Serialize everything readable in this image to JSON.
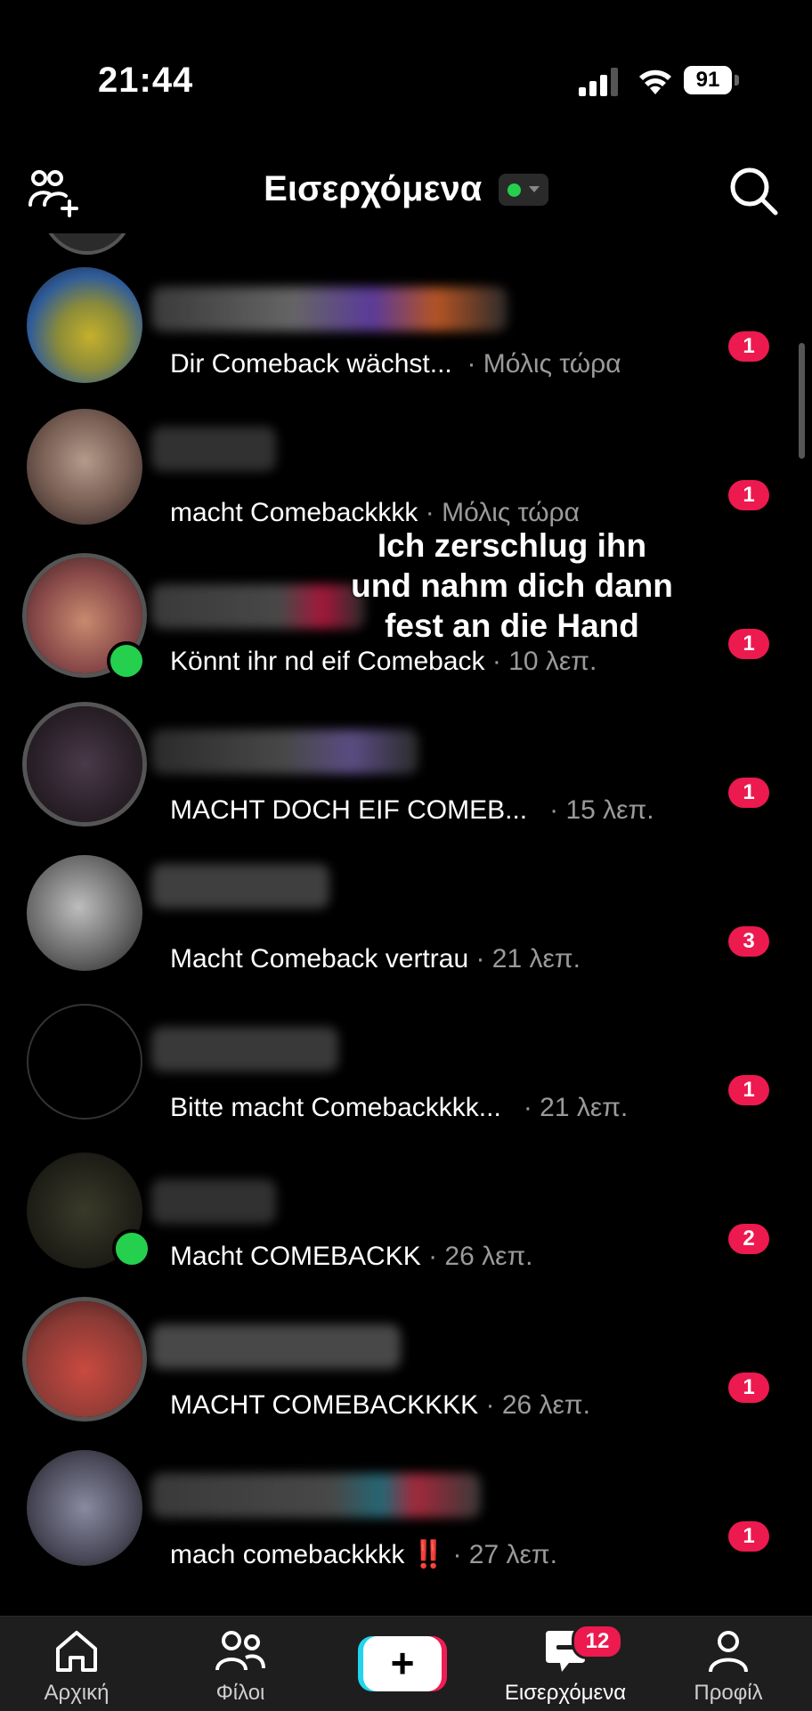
{
  "status_bar": {
    "time": "21:44",
    "battery": "91"
  },
  "header": {
    "title": "Εισερχόμενα"
  },
  "conversations": [
    {
      "message": "Dir Comeback wächst...",
      "time": "· Μόλις τώρα",
      "unread": "1"
    },
    {
      "message": "macht Comebackkkk",
      "time": "· Μόλις τώρα",
      "unread": "1"
    },
    {
      "message": "Könnt ihr nd eif Comeback",
      "time": "· 10 λεπ.",
      "unread": "1"
    },
    {
      "message": "MACHT DOCH EIF COMEB...",
      "time": "· 15 λεπ.",
      "unread": "1"
    },
    {
      "message": "Macht Comeback vertrau",
      "time": "· 21 λεπ.",
      "unread": "3"
    },
    {
      "message": "Bitte macht Comebackkkk...",
      "time": "· 21 λεπ.",
      "unread": "1"
    },
    {
      "message": "Macht COMEBACKK",
      "time": "· 26 λεπ.",
      "unread": "2"
    },
    {
      "message": "MACHT COMEBACKKKK",
      "time": "· 26 λεπ.",
      "unread": "1"
    },
    {
      "message": "mach comebackkkk ‼️",
      "time": "· 27 λεπ.",
      "unread": "1"
    }
  ],
  "overlay_caption": [
    "Ich zerschlug ihn",
    "und nahm dich dann",
    "fest an die Hand"
  ],
  "tab_bar": {
    "home": "Αρχική",
    "friends": "Φίλοι",
    "create": "+",
    "inbox": "Εισερχόμενα",
    "inbox_badge": "12",
    "profile": "Προφίλ"
  },
  "colors": {
    "accent": "#ec1a4f",
    "online": "#25d04e",
    "background": "#000000"
  }
}
